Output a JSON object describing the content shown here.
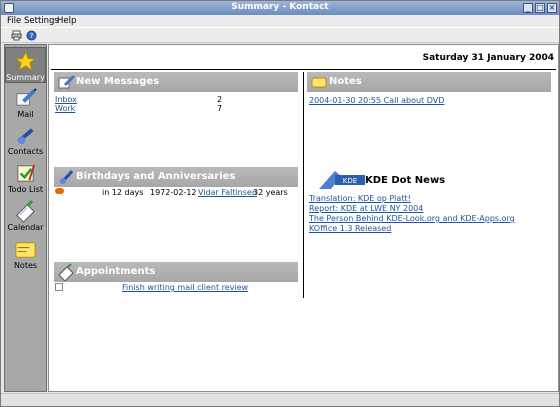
{
  "window": {
    "title": "Summary - Kontact"
  },
  "menu": [
    "File",
    "Settings",
    "Help"
  ],
  "toolbar": {
    "icons": [
      "print-icon",
      "help-icon"
    ]
  },
  "sidebar": {
    "items": [
      {
        "label": "Summary",
        "icon": "star-icon",
        "active": true
      },
      {
        "label": "Mail",
        "icon": "mail-icon",
        "active": false
      },
      {
        "label": "Contacts",
        "icon": "contacts-icon",
        "active": false
      },
      {
        "label": "Todo List",
        "icon": "todo-icon",
        "active": false
      },
      {
        "label": "Calendar",
        "icon": "calendar-icon",
        "active": false
      },
      {
        "label": "Notes",
        "icon": "notes-icon",
        "active": false
      }
    ]
  },
  "main": {
    "date": "Saturday 31 January 2004",
    "new_messages": {
      "title": "New Messages",
      "rows": [
        {
          "folder": "Inbox",
          "count": "2"
        },
        {
          "folder": "Work",
          "count": "7"
        }
      ]
    },
    "birthdays": {
      "title": "Birthdays and Anniversaries",
      "rows": [
        {
          "when": "in 12 days",
          "date": "1972-02-12",
          "name": "Vidar Faltinsen",
          "age": "32 years"
        }
      ]
    },
    "appointments": {
      "title": "Appointments",
      "rows": [
        {
          "text": "Finish writing mail client review"
        }
      ]
    },
    "notes": {
      "title": "Notes",
      "items": [
        "2004-01-30 20:55 Call about DVD"
      ]
    },
    "kde_news": {
      "title": "KDE Dot News",
      "logo_text": "KDE",
      "items": [
        "Translation: KDE op Platt!",
        "Report: KDE at LWE NY 2004",
        "The Person Behind KDE-Look.org and KDE-Apps.org",
        "KOffice 1.3 Released"
      ]
    }
  },
  "colors": {
    "link": "#23549b",
    "section_header": "#aeaeae",
    "sidebar": "#a8a8a8"
  }
}
